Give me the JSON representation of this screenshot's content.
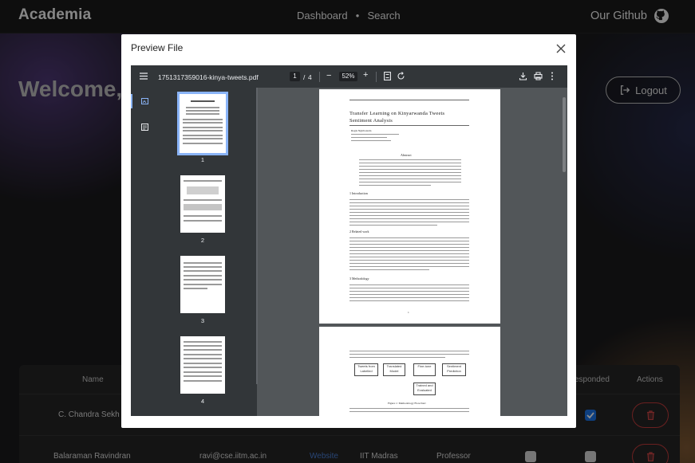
{
  "navbar": {
    "brand": "Academia",
    "links": [
      "Dashboard",
      "Search"
    ],
    "github_label": "Our Github",
    "icons": {
      "github": "github-icon"
    }
  },
  "page": {
    "welcome": "Welcome,",
    "logout_label": "Logout"
  },
  "table": {
    "headers": [
      "Name",
      "esponded",
      "Actions"
    ],
    "rows": [
      {
        "name": "C. Chandra Sekh",
        "responded": true
      },
      {
        "name": "Balaraman Ravindran",
        "email": "ravi@cse.iitm.ac.in",
        "website": "Website",
        "institution": "IIT Madras",
        "designation": "Professor",
        "responded": false
      }
    ]
  },
  "modal": {
    "title": "Preview File",
    "viewer": {
      "filename": "1751317359016-kinya-tweets.pdf",
      "current_page": "1",
      "page_separator": "/",
      "total_pages": "4",
      "zoom": "52%",
      "thumbnail_labels": [
        "1",
        "2",
        "3",
        "4"
      ],
      "document": {
        "title_line1": "Transfer Learning on Kinyarwanda Tweets",
        "title_line2": "Sentiment Analysis",
        "author": "Regis Ngiriwanda",
        "section_abstract": "Abstract",
        "section_1": "1   Introduction",
        "section_2": "2   Related work",
        "section_3": "3   Methodology",
        "page_number": "1",
        "flow_boxes": [
          "Tweets from Labelled",
          "Translated Model",
          "Fine-tune",
          "Sentiment Prediction",
          "Trained and Evaluated"
        ],
        "figure_caption": "Figure 1: Methodology Flowchart"
      }
    }
  },
  "colors": {
    "accent": "#8ab4f8",
    "danger": "#c23b3b",
    "checkbox_checked": "#1a73e8"
  }
}
